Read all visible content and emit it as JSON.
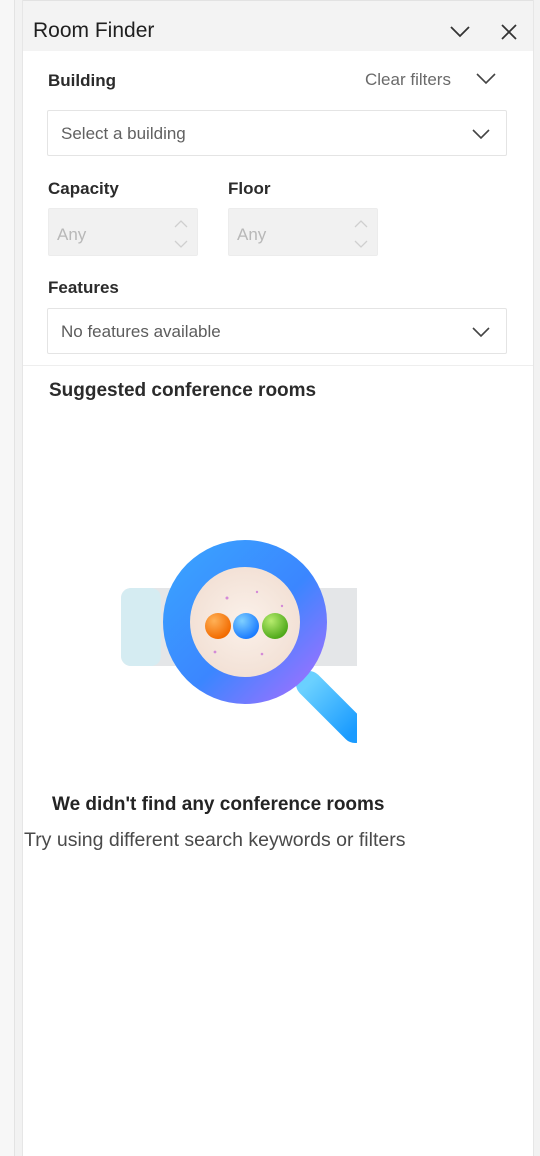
{
  "header": {
    "title": "Room Finder"
  },
  "filters": {
    "building_label": "Building",
    "clear_filters": "Clear filters",
    "building_placeholder": "Select a building",
    "capacity_label": "Capacity",
    "capacity_value": "Any",
    "floor_label": "Floor",
    "floor_value": "Any",
    "features_label": "Features",
    "features_placeholder": "No features available"
  },
  "results": {
    "heading": "Suggested conference rooms",
    "empty_title": "We didn't find any conference rooms",
    "empty_subtitle": "Try using different search keywords or filters"
  },
  "icons": {
    "collapse": "chevron-down-icon",
    "close": "close-icon",
    "illustration": "magnifier-illustration-icon"
  }
}
